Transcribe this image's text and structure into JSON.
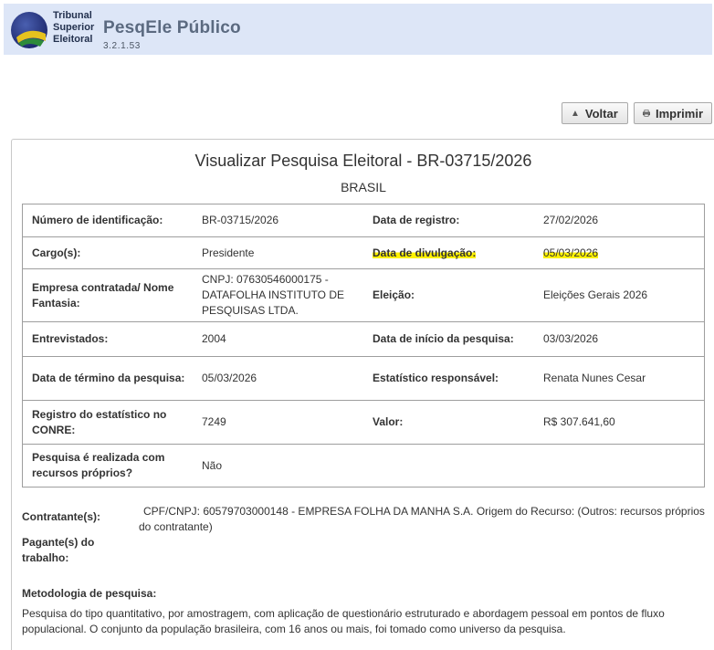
{
  "header": {
    "org_line1": "Tribunal",
    "org_line2": "Superior",
    "org_line3": "Eleitoral",
    "app_title": "PesqEle Público",
    "version": "3.2.1.53"
  },
  "toolbar": {
    "back_label": "Voltar",
    "print_label": "Imprimir"
  },
  "page": {
    "title": "Visualizar Pesquisa Eleitoral - BR-03715/2026",
    "subtitle": "BRASIL"
  },
  "info": [
    {
      "l1": "Número de identificação:",
      "v1": "BR-03715/2026",
      "l2": "Data de registro:",
      "v2": "27/02/2026"
    },
    {
      "l1": "Cargo(s):",
      "v1": "Presidente",
      "l2": "Data de divulgação:",
      "v2": "05/03/2026"
    },
    {
      "l1": "Empresa contratada/ Nome Fantasia:",
      "v1": "CNPJ: 07630546000175 - DATAFOLHA INSTITUTO DE PESQUISAS LTDA.",
      "l2": "Eleição:",
      "v2": "Eleições Gerais 2026"
    },
    {
      "l1": "Entrevistados:",
      "v1": "2004",
      "l2": "Data de início da pesquisa:",
      "v2": "03/03/2026"
    },
    {
      "l1": "Data de término da pesquisa:",
      "v1": "05/03/2026",
      "l2": "Estatístico responsável:",
      "v2": "Renata Nunes Cesar"
    },
    {
      "l1": "Registro do estatístico no CONRE:",
      "v1": "7249",
      "l2": "Valor:",
      "v2": "R$ 307.641,60"
    },
    {
      "l1": "Pesquisa é realizada com recursos próprios?",
      "v1": "Não",
      "l2": "",
      "v2": ""
    }
  ],
  "contratante": {
    "label": "Contratante(s):",
    "line1": "CPF/CNPJ: 60579703000148 - EMPRESA FOLHA DA MANHA S.A. Origem do Recurso: (Outros: recursos próprios",
    "line2": "do contratante)"
  },
  "pagante": {
    "label": "Pagante(s) do trabalho:"
  },
  "metodologia": {
    "label": "Metodologia de pesquisa:",
    "text": "Pesquisa do tipo quantitativo, por amostragem, com aplicação de questionário estruturado e abordagem pessoal em pontos de fluxo populacional. O conjunto da população brasileira, com 16 anos ou mais, foi tomado como universo da pesquisa."
  },
  "colors": {
    "header_bg": "#dde6f7",
    "highlight": "#fff200",
    "border": "#9e9e9e"
  },
  "icons": [
    "tse-globe-logo",
    "chevron-up-icon",
    "printer-icon"
  ]
}
